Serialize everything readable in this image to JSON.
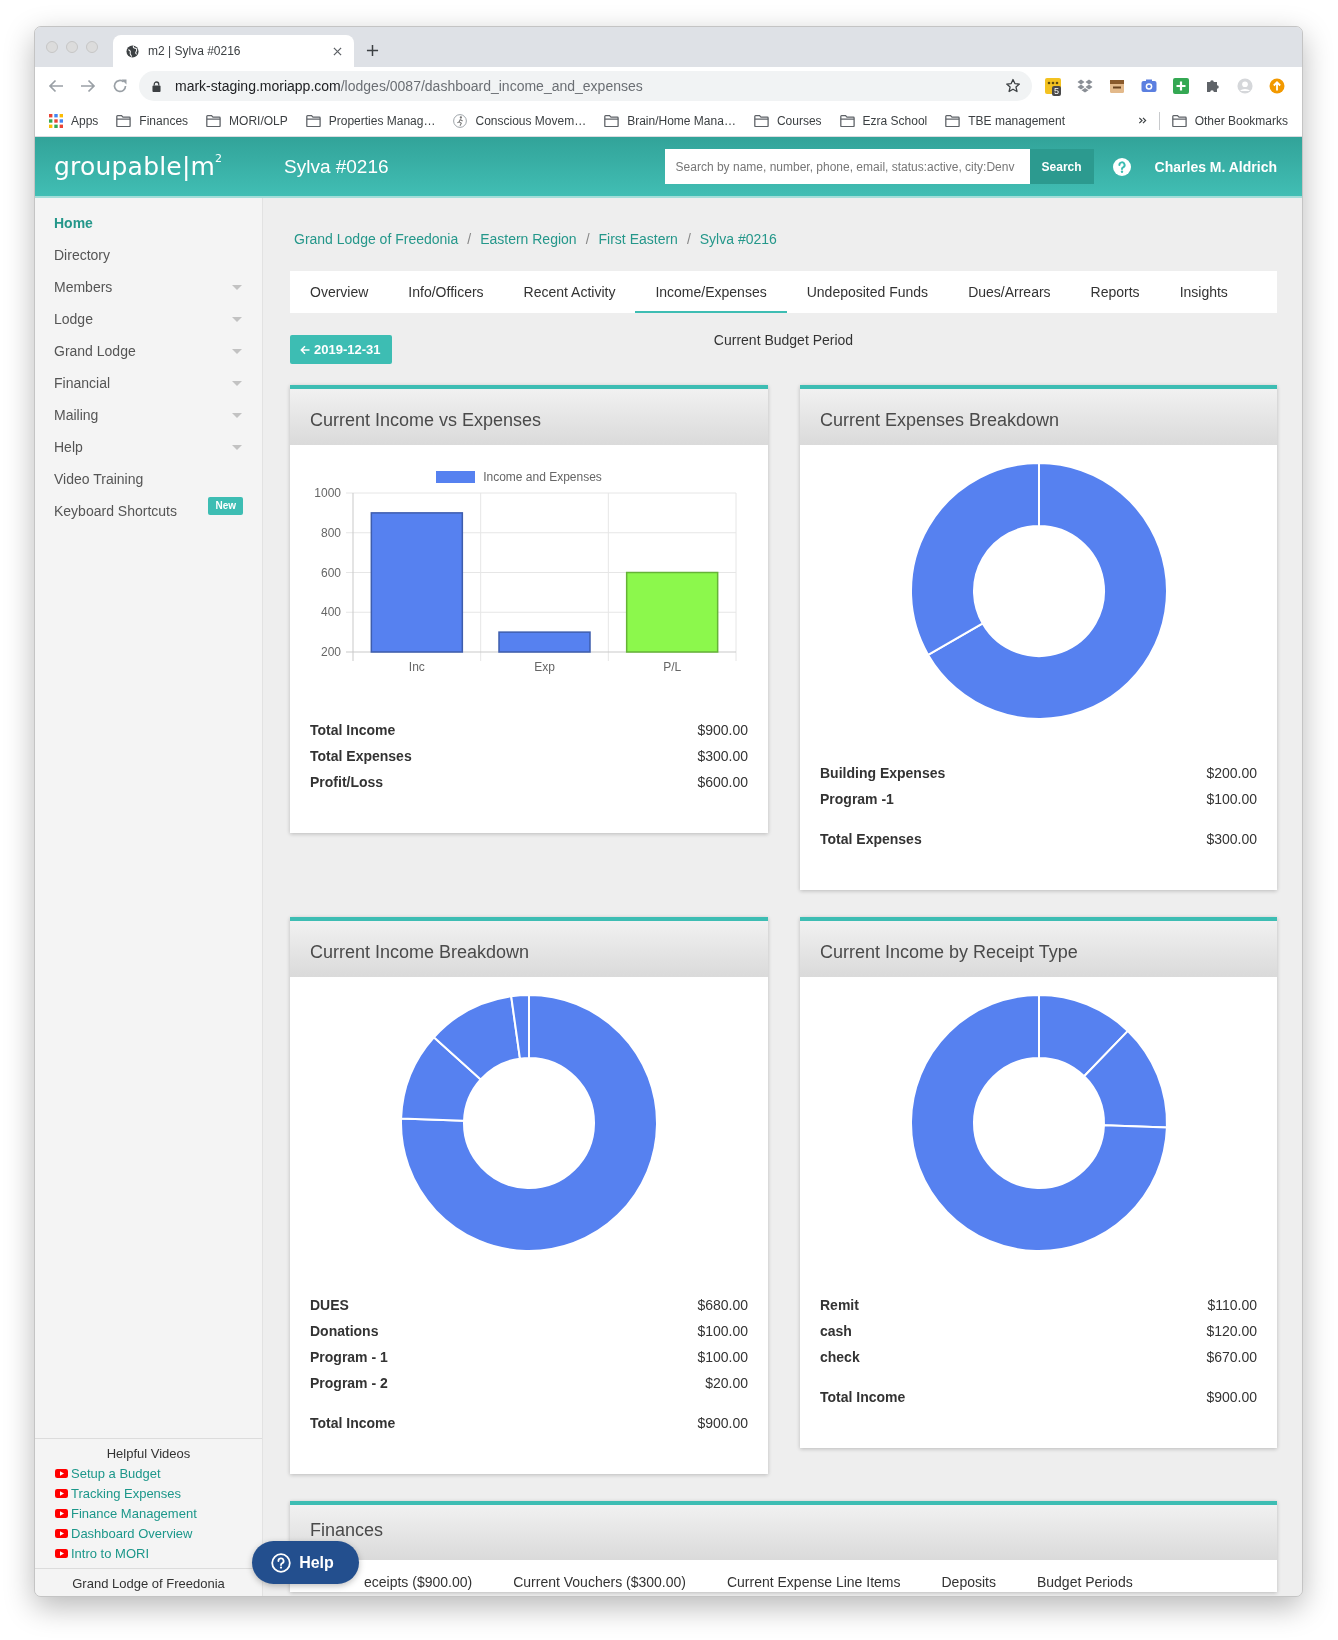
{
  "browser": {
    "tab_title": "m2 | Sylva #0216",
    "url_host": "mark-staging.moriapp.com",
    "url_path": "/lodges/0087/dashboard_income_and_expenses",
    "extension_badge": "5",
    "bookmarks": [
      {
        "label": "Apps",
        "kind": "apps"
      },
      {
        "label": "Finances",
        "kind": "folder"
      },
      {
        "label": "MORI/OLP",
        "kind": "folder"
      },
      {
        "label": "Properties Manag…",
        "kind": "folder"
      },
      {
        "label": "Conscious Movem…",
        "kind": "site"
      },
      {
        "label": "Brain/Home Mana…",
        "kind": "folder"
      },
      {
        "label": "Courses",
        "kind": "folder"
      },
      {
        "label": "Ezra School",
        "kind": "folder"
      },
      {
        "label": "TBE management",
        "kind": "folder"
      }
    ],
    "other_bookmarks": "Other Bookmarks"
  },
  "header": {
    "logo": "groupable|m$^{2}$",
    "title": "Sylva #0216",
    "search": {
      "placeholder": "Search by name, number, phone, email, status:active, city:Denv"
    },
    "search_button": "Search",
    "user": "Charles M. Aldrich"
  },
  "sidebar": {
    "items": [
      {
        "label": "Home",
        "selected": true,
        "expandable": false
      },
      {
        "label": "Directory",
        "selected": false,
        "expandable": false
      },
      {
        "label": "Members",
        "selected": false,
        "expandable": true
      },
      {
        "label": "Lodge",
        "selected": false,
        "expandable": true
      },
      {
        "label": "Grand Lodge",
        "selected": false,
        "expandable": true
      },
      {
        "label": "Financial",
        "selected": false,
        "expandable": true
      },
      {
        "label": "Mailing",
        "selected": false,
        "expandable": true
      },
      {
        "label": "Help",
        "selected": false,
        "expandable": true
      },
      {
        "label": "Video Training",
        "selected": false,
        "expandable": false
      },
      {
        "label": "Keyboard Shortcuts",
        "selected": false,
        "expandable": false,
        "badge": "New"
      }
    ],
    "videos": {
      "title": "Helpful Videos",
      "links": [
        "Setup a Budget",
        "Tracking Expenses",
        "Finance Management",
        "Dashboard Overview",
        "Intro to MORI"
      ]
    },
    "footer": "Grand Lodge of Freedonia"
  },
  "breadcrumb": [
    {
      "label": "Grand Lodge of Freedonia",
      "separator": "/"
    },
    {
      "label": "Eastern Region",
      "separator": "/"
    },
    {
      "label": "First Eastern",
      "separator": "/"
    },
    {
      "label": "Sylva #0216"
    }
  ],
  "tabs": [
    {
      "label": "Overview",
      "selected": false
    },
    {
      "label": "Info/Officers",
      "selected": false
    },
    {
      "label": "Recent Activity",
      "selected": false
    },
    {
      "label": "Income/Expenses",
      "selected": true
    },
    {
      "label": "Undeposited Funds",
      "selected": false
    },
    {
      "label": "Dues/Arrears",
      "selected": false
    },
    {
      "label": "Reports",
      "selected": false
    },
    {
      "label": "Insights",
      "selected": false
    }
  ],
  "period": {
    "back_button": "2019-12-31",
    "label": "Current Budget Period"
  },
  "cards": [
    {
      "title": "Current Income vs Expenses",
      "chart_data": {
        "type": "bar",
        "categories": [
          "Inc",
          "Exp",
          "P/L"
        ],
        "series": [
          {
            "name": "Income and Expenses",
            "color": "#5681f0",
            "values": [
              900,
              300,
              null
            ]
          },
          {
            "color": "#8cf84c",
            "values": [
              null,
              null,
              600
            ]
          }
        ],
        "stacked": true,
        "grid": true,
        "ylim": [
          200,
          1000
        ],
        "yticks": [
          200,
          400,
          600,
          800,
          1000
        ]
      },
      "rows": [
        {
          "label": "Total Income",
          "value": "$900.00"
        },
        {
          "label": "Total Expenses",
          "value": "$300.00"
        },
        {
          "label": "Profit/Loss",
          "value": "$600.00"
        }
      ]
    },
    {
      "title": "Current Expenses Breakdown",
      "chart_data": {
        "type": "donut",
        "series": [
          {
            "color": "#5681f0",
            "values": [
              66.67,
              33.33
            ]
          }
        ]
      },
      "rows": [
        {
          "label": "Building Expenses",
          "value": "$200.00"
        },
        {
          "label": "Program -1",
          "value": "$100.00"
        }
      ],
      "total": {
        "label": "Total Expenses",
        "value": "$300.00"
      }
    },
    {
      "title": "Current Income Breakdown",
      "chart_data": {
        "type": "donut",
        "series": [
          {
            "color": "#5681f0",
            "values": [
              75.56,
              11.11,
              11.11,
              2.22
            ]
          }
        ]
      },
      "rows": [
        {
          "label": "DUES",
          "value": "$680.00"
        },
        {
          "label": "Donations",
          "value": "$100.00"
        },
        {
          "label": "Program - 1",
          "value": "$100.00"
        },
        {
          "label": "Program - 2",
          "value": "$20.00"
        }
      ],
      "total": {
        "label": "Total Income",
        "value": "$900.00"
      }
    },
    {
      "title": "Current Income by Receipt Type",
      "chart_data": {
        "type": "donut",
        "series": [
          {
            "color": "#5681f0",
            "values": [
              12.22,
              13.33,
              74.45
            ]
          }
        ]
      },
      "rows": [
        {
          "label": "Remit",
          "value": "$110.00"
        },
        {
          "label": "cash",
          "value": "$120.00"
        },
        {
          "label": "check",
          "value": "$670.00"
        }
      ],
      "total": {
        "label": "Total Income",
        "value": "$900.00"
      }
    }
  ],
  "finances": {
    "title": "Finances",
    "tabs": [
      "eceipts ($900.00)",
      "Current Vouchers ($300.00)",
      "Current Expense Line Items",
      "Deposits",
      "Budget Periods"
    ]
  },
  "help_button": "Help"
}
